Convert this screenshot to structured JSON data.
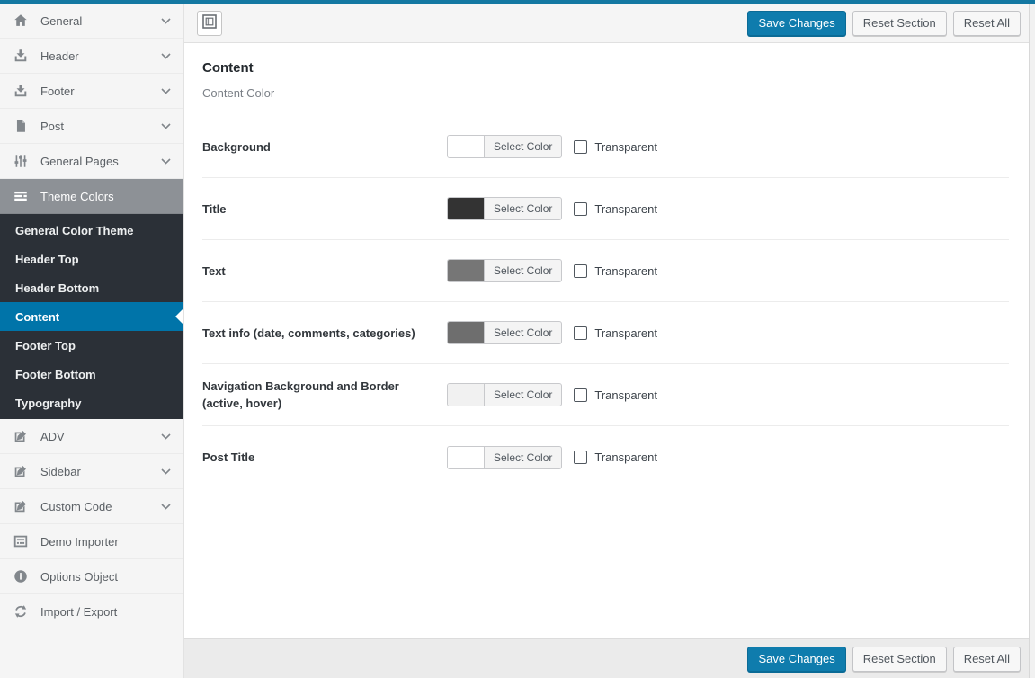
{
  "colors": {
    "top_bar_teal": "#1478a2",
    "accent_blue": "#0074a9",
    "primary_button_blue": "#0f7cad",
    "sidebar_active_parent_gray": "#8d9196",
    "submenu_dark": "#2b3037",
    "sidebar_bg": "#f5f5f5"
  },
  "sidebar": {
    "top_items": [
      {
        "label": "General",
        "icon": "home-icon",
        "has_chevron": true
      },
      {
        "label": "Header",
        "icon": "download-icon",
        "has_chevron": true
      },
      {
        "label": "Footer",
        "icon": "download-icon",
        "has_chevron": true
      },
      {
        "label": "Post",
        "icon": "post-icon",
        "has_chevron": true
      },
      {
        "label": "General Pages",
        "icon": "sliders-icon",
        "has_chevron": true
      }
    ],
    "theme_colors": {
      "label": "Theme Colors",
      "icon": "lines-icon",
      "active": true
    },
    "submenu": [
      "General Color Theme",
      "Header Top",
      "Header Bottom",
      "Content",
      "Footer Top",
      "Footer Bottom",
      "Typography"
    ],
    "submenu_active": "Content",
    "bottom_items": [
      {
        "label": "ADV",
        "icon": "edit-icon",
        "has_chevron": true
      },
      {
        "label": "Sidebar",
        "icon": "edit-icon",
        "has_chevron": true
      },
      {
        "label": "Custom Code",
        "icon": "edit-icon",
        "has_chevron": true
      },
      {
        "label": "Demo Importer",
        "icon": "screen-icon",
        "has_chevron": false
      },
      {
        "label": "Options Object",
        "icon": "info-icon",
        "has_chevron": false
      },
      {
        "label": "Import / Export",
        "icon": "refresh-icon",
        "has_chevron": false
      }
    ]
  },
  "buttons": {
    "save": "Save Changes",
    "reset_section": "Reset Section",
    "reset_all": "Reset All"
  },
  "content": {
    "title": "Content",
    "subtitle": "Content Color",
    "select_color_label": "Select Color",
    "transparent_label": "Transparent",
    "rows": [
      {
        "label": "Background",
        "swatch": "#ffffff",
        "transparent_checked": false
      },
      {
        "label": "Title",
        "swatch": "#333333",
        "transparent_checked": false
      },
      {
        "label": "Text",
        "swatch": "#767676",
        "transparent_checked": false
      },
      {
        "label": "Text info (date, comments, categories)",
        "swatch": "#6e6e6e",
        "transparent_checked": false
      },
      {
        "label": "Navigation Background and Border (active, hover)",
        "swatch": "#f1f1f1",
        "transparent_checked": false
      },
      {
        "label": "Post Title",
        "swatch": "#ffffff",
        "transparent_checked": false
      }
    ]
  }
}
